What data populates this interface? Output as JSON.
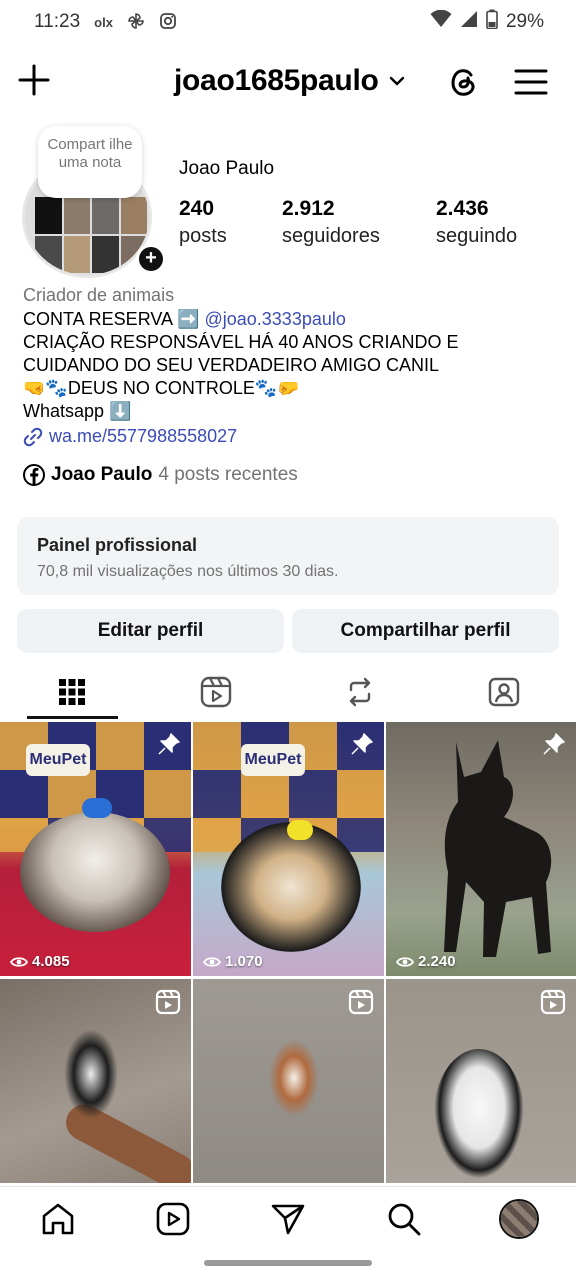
{
  "status_bar": {
    "time": "11:23",
    "app_icons": [
      "olx-icon",
      "pinwheel-icon",
      "instagram-icon"
    ],
    "battery": "29%"
  },
  "header": {
    "username": "joao1685paulo"
  },
  "profile": {
    "note_text": "Compart ilhe uma nota",
    "name": "Joao Paulo",
    "stats": [
      {
        "value": "240",
        "label": "posts"
      },
      {
        "value": "2.912",
        "label": "seguidores"
      },
      {
        "value": "2.436",
        "label": "seguindo"
      }
    ]
  },
  "bio": {
    "category": "Criador de animais",
    "line1_text": "CONTA RESERVA ➡️",
    "line1_mention": "@joao.3333paulo",
    "line2": "CRIAÇÃO RESPONSÁVEL HÁ 40 ANOS CRIANDO E",
    "line3": "CUIDANDO DO SEU VERDADEIRO AMIGO CANIL",
    "line4": "🤜🐾DEUS NO CONTROLE🐾🤛",
    "line5": "Whatsapp ⬇️",
    "link": "wa.me/5577988558027"
  },
  "facebook": {
    "name": "Joao Paulo",
    "meta": "4 posts recentes"
  },
  "dashboard": {
    "title": "Painel profissional",
    "subtitle": "70,8 mil visualizações nos últimos 30 dias."
  },
  "buttons": {
    "edit": "Editar perfil",
    "share": "Compartilhar perfil"
  },
  "tabs": [
    "grid-icon",
    "reels-icon",
    "reposts-icon",
    "tagged-icon"
  ],
  "posts": [
    {
      "type": "pinned",
      "views": "4.085",
      "logo": "MeuPet"
    },
    {
      "type": "pinned",
      "views": "1.070",
      "logo": "MeuPet"
    },
    {
      "type": "pinned",
      "views": "2.240"
    },
    {
      "type": "reel"
    },
    {
      "type": "reel"
    },
    {
      "type": "reel"
    }
  ],
  "bottom_nav": [
    "home-icon",
    "reels-icon",
    "send-icon",
    "search-icon",
    "profile-avatar"
  ]
}
